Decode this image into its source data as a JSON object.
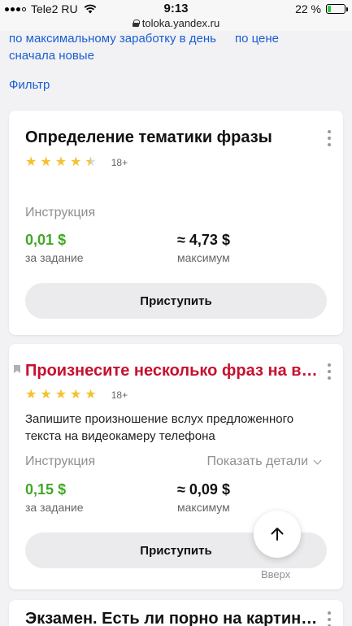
{
  "status_bar": {
    "carrier": "Tele2 RU",
    "time": "9:13",
    "battery": "22 %",
    "battery_level": 0.22,
    "url": "toloka.yandex.ru"
  },
  "sort_options": [
    "по максимальному заработку в день",
    "по цене",
    "сначала новые"
  ],
  "filter_label": "Фильтр",
  "cards": [
    {
      "title": "Определение тематики фразы",
      "title_color": "#111111",
      "stars": 4.5,
      "age": "18+",
      "instruction": "Инструкция",
      "reward": "0,01",
      "reward_unit": "за задание",
      "max": "≈ 4,73",
      "max_unit": "максимум",
      "button": "Приступить"
    },
    {
      "title": "Произнесите несколько фраз на виде...",
      "title_color": "#c8102e",
      "stars": 5,
      "age": "18+",
      "description": "Запишите произношение вслух предложенного текста на видеокамеру телефона",
      "instruction": "Инструкция",
      "details": "Показать детали",
      "reward": "0,15",
      "reward_unit": "за задание",
      "max": "≈ 0,09",
      "max_unit": "максимум",
      "button": "Приступить"
    },
    {
      "title": "Экзамен. Есть ли порно на картинке?"
    }
  ],
  "currency": "$",
  "scroll_up_label": "Вверх",
  "colors": {
    "link": "#1b5ecf",
    "reward_green": "#41a827",
    "star": "#f2c230"
  }
}
